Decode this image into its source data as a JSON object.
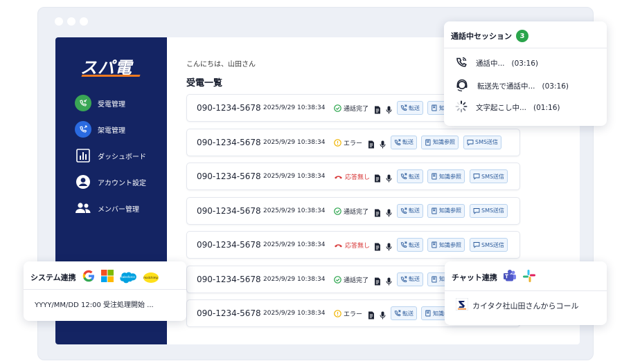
{
  "sidebar": {
    "logo": "スパ電",
    "items": [
      {
        "label": "受電管理",
        "icon": "incoming-call-icon"
      },
      {
        "label": "架電管理",
        "icon": "outgoing-call-icon"
      },
      {
        "label": "ダッシュボード",
        "icon": "dashboard-chart-icon"
      },
      {
        "label": "アカウント設定",
        "icon": "account-icon"
      },
      {
        "label": "メンバー管理",
        "icon": "members-icon"
      }
    ]
  },
  "main": {
    "greeting": "こんにちは、山田さん",
    "title": "受電一覧",
    "rows": [
      {
        "phone": "090-1234-5678",
        "datetime": "2025/9/29 10:38:34",
        "status": "通話完了",
        "status_type": "done"
      },
      {
        "phone": "090-1234-5678",
        "datetime": "2025/9/29 10:38:34",
        "status": "エラー",
        "status_type": "error"
      },
      {
        "phone": "090-1234-5678",
        "datetime": "2025/9/29 10:38:34",
        "status": "応答無し",
        "status_type": "missed"
      },
      {
        "phone": "090-1234-5678",
        "datetime": "2025/9/29 10:38:34",
        "status": "通話完了",
        "status_type": "done"
      },
      {
        "phone": "090-1234-5678",
        "datetime": "2025/9/29 10:38:34",
        "status": "応答無し",
        "status_type": "missed"
      },
      {
        "phone": "090-1234-5678",
        "datetime": "2025/9/29 10:38:34",
        "status": "通話完了",
        "status_type": "done"
      },
      {
        "phone": "090-1234-5678",
        "datetime": "2025/9/29 10:38:34",
        "status": "エラー",
        "status_type": "error"
      }
    ],
    "actions": {
      "transfer": "転送",
      "knowledge": "知識参照",
      "sms": "SMS送信"
    }
  },
  "session_card": {
    "title": "通話中セッション",
    "count": "3",
    "items": [
      {
        "label": "通話中...",
        "time": "(03:16)",
        "icon": "phone-active-icon"
      },
      {
        "label": "転送先で通話中...",
        "time": "(03:16)",
        "icon": "headset-icon"
      },
      {
        "label": "文字起こし中...",
        "time": "(01:16)",
        "icon": "loading-spinner-icon"
      }
    ]
  },
  "system_card": {
    "title": "システム連携",
    "logos": [
      "google-logo-icon",
      "microsoft-logo-icon",
      "salesforce-logo-icon",
      "mailchimp-logo-icon"
    ],
    "logo_text": {
      "salesforce": "salesforce",
      "mailchimp": "mailchimp"
    },
    "message": "YYYY/MM/DD 12:00 受注処理開始 ..."
  },
  "chat_card": {
    "title": "チャット連携",
    "logos": [
      "teams-logo-icon",
      "slack-logo-icon"
    ],
    "message": "カイタク社山田さんからコール"
  },
  "colors": {
    "sidebar": "#142463",
    "accent": "#ef7a1f",
    "badge": "#2aa44b",
    "missed": "#d83b3b",
    "error": "#f0b400",
    "done": "#2aa44b"
  }
}
